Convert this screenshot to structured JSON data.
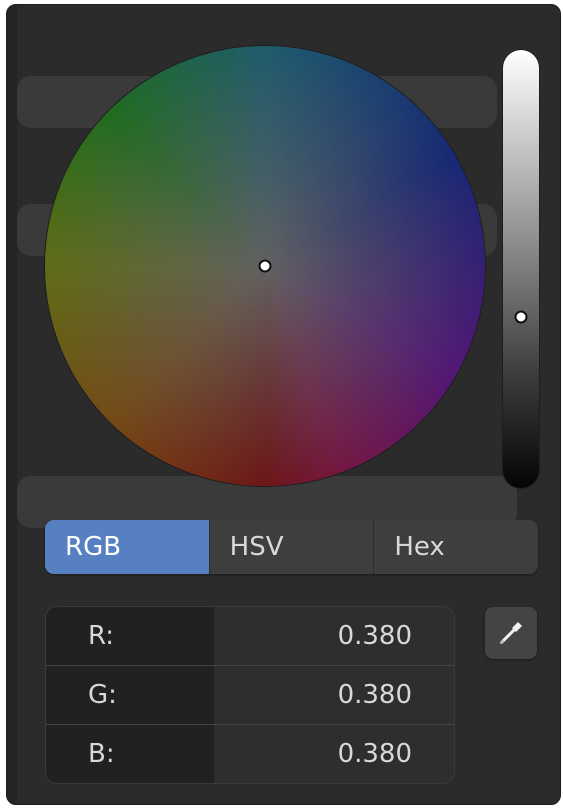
{
  "color_picker": {
    "value_level": 0.38,
    "tabs": [
      {
        "label": "RGB",
        "active": true
      },
      {
        "label": "HSV",
        "active": false
      },
      {
        "label": "Hex",
        "active": false
      }
    ],
    "fields": [
      {
        "label": "R:",
        "value": "0.380"
      },
      {
        "label": "G:",
        "value": "0.380"
      },
      {
        "label": "B:",
        "value": "0.380"
      }
    ],
    "eyedropper_icon": "eyedropper-icon",
    "accent_color": "#5680c2"
  }
}
